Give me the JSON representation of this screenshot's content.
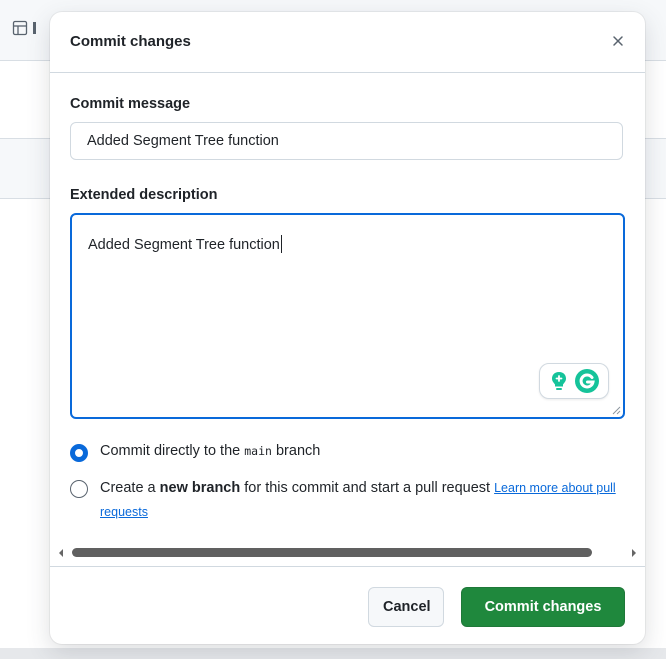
{
  "dialog": {
    "title": "Commit changes",
    "close_icon": "close-icon"
  },
  "commit_message": {
    "label": "Commit message",
    "value": "Added Segment Tree function"
  },
  "extended_description": {
    "label": "Extended description",
    "value": "Added Segment Tree function",
    "grammarly_icons": [
      "lightbulb-icon",
      "grammarly-g-icon"
    ]
  },
  "options": {
    "direct": {
      "prefix": "Commit directly to the ",
      "branch": "main",
      "suffix": " branch",
      "selected": true
    },
    "new_branch": {
      "prefix": "Create a ",
      "bold": "new branch",
      "suffix": " for this commit and start a pull request ",
      "link": "Learn more about pull requests",
      "selected": false
    }
  },
  "footer": {
    "cancel_label": "Cancel",
    "commit_label": "Commit changes"
  },
  "colors": {
    "accent": "#0969da",
    "primary_button": "#1f883d",
    "grammarly_green": "#15c39a"
  }
}
